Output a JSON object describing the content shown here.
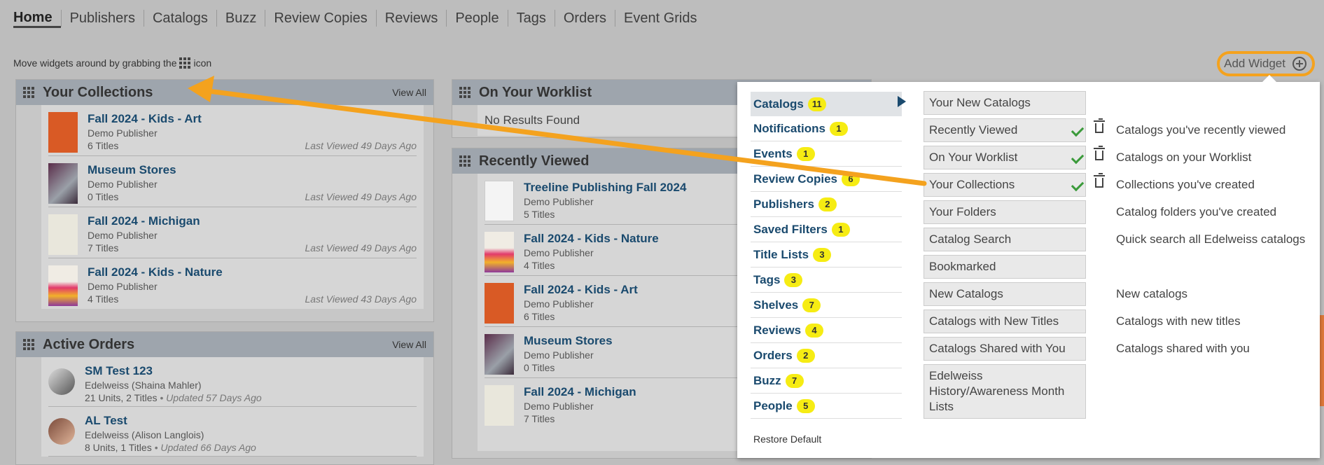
{
  "nav": {
    "items": [
      "Home",
      "Publishers",
      "Catalogs",
      "Buzz",
      "Review Copies",
      "Reviews",
      "People",
      "Tags",
      "Orders",
      "Event Grids"
    ]
  },
  "hint": {
    "before": "Move widgets around by grabbing the",
    "after": "icon"
  },
  "add_widget": {
    "label": "Add Widget",
    "icon": "plus-circle-icon"
  },
  "collections": {
    "title": "Your Collections",
    "view_all": "View All",
    "items": [
      {
        "name": "Fall 2024 - Kids - Art",
        "publisher": "Demo Publisher",
        "count": "6 Titles",
        "last_viewed": "Last Viewed 49 Days Ago"
      },
      {
        "name": "Museum Stores",
        "publisher": "Demo Publisher",
        "count": "0 Titles",
        "last_viewed": "Last Viewed 49 Days Ago"
      },
      {
        "name": "Fall 2024 - Michigan",
        "publisher": "Demo Publisher",
        "count": "7 Titles",
        "last_viewed": "Last Viewed 49 Days Ago"
      },
      {
        "name": "Fall 2024 - Kids - Nature",
        "publisher": "Demo Publisher",
        "count": "4 Titles",
        "last_viewed": "Last Viewed 43 Days Ago"
      }
    ]
  },
  "orders": {
    "title": "Active Orders",
    "view_all": "View All",
    "items": [
      {
        "name": "SM Test 123",
        "owner": "Edelweiss (Shaina Mahler)",
        "units": "21 Units, 2 Titles",
        "updated": "• Updated 57 Days Ago"
      },
      {
        "name": "AL Test",
        "owner": "Edelweiss (Alison Langlois)",
        "units": "8 Units, 1 Titles",
        "updated": "• Updated 66 Days Ago"
      }
    ]
  },
  "worklist": {
    "title": "On Your Worklist",
    "empty": "No Results Found"
  },
  "recent": {
    "title": "Recently Viewed",
    "items": [
      {
        "name": "Treeline Publishing Fall 2024",
        "publisher": "Demo Publisher",
        "count": "5 Titles"
      },
      {
        "name": "Fall 2024 - Kids - Nature",
        "publisher": "Demo Publisher",
        "count": "4 Titles"
      },
      {
        "name": "Fall 2024 - Kids - Art",
        "publisher": "Demo Publisher",
        "count": "6 Titles"
      },
      {
        "name": "Museum Stores",
        "publisher": "Demo Publisher",
        "count": "0 Titles"
      },
      {
        "name": "Fall 2024 - Michigan",
        "publisher": "Demo Publisher",
        "count": "7 Titles"
      }
    ]
  },
  "dropdown": {
    "categories": [
      {
        "label": "Catalogs",
        "count": "11"
      },
      {
        "label": "Notifications",
        "count": "1"
      },
      {
        "label": "Events",
        "count": "1"
      },
      {
        "label": "Review Copies",
        "count": "6"
      },
      {
        "label": "Publishers",
        "count": "2"
      },
      {
        "label": "Saved Filters",
        "count": "1"
      },
      {
        "label": "Title Lists",
        "count": "3"
      },
      {
        "label": "Tags",
        "count": "3"
      },
      {
        "label": "Shelves",
        "count": "7"
      },
      {
        "label": "Reviews",
        "count": "4"
      },
      {
        "label": "Orders",
        "count": "2"
      },
      {
        "label": "Buzz",
        "count": "7"
      },
      {
        "label": "People",
        "count": "5"
      }
    ],
    "restore": "Restore Default",
    "options": [
      {
        "label": "Your New Catalogs",
        "desc": ""
      },
      {
        "label": "Recently Viewed",
        "desc": "Catalogs you've recently viewed"
      },
      {
        "label": "On Your Worklist",
        "desc": "Catalogs on your Worklist"
      },
      {
        "label": "Your Collections",
        "desc": "Collections you've created"
      },
      {
        "label": "Your Folders",
        "desc": "Catalog folders you've created"
      },
      {
        "label": "Catalog Search",
        "desc": "Quick search all Edelweiss catalogs"
      },
      {
        "label": "Bookmarked",
        "desc": ""
      },
      {
        "label": "New Catalogs",
        "desc": "New catalogs"
      },
      {
        "label": "Catalogs with New Titles",
        "desc": "Catalogs with new titles"
      },
      {
        "label": "Catalogs Shared with You",
        "desc": "Catalogs shared with you"
      },
      {
        "label": "Edelweiss History/Awareness Month Lists",
        "desc": ""
      }
    ]
  },
  "colors": {
    "accent_orange": "#f4a21e",
    "badge_yellow": "#f6ec13",
    "link_blue": "#1a4a6e",
    "check_green": "#3a9a3a"
  }
}
